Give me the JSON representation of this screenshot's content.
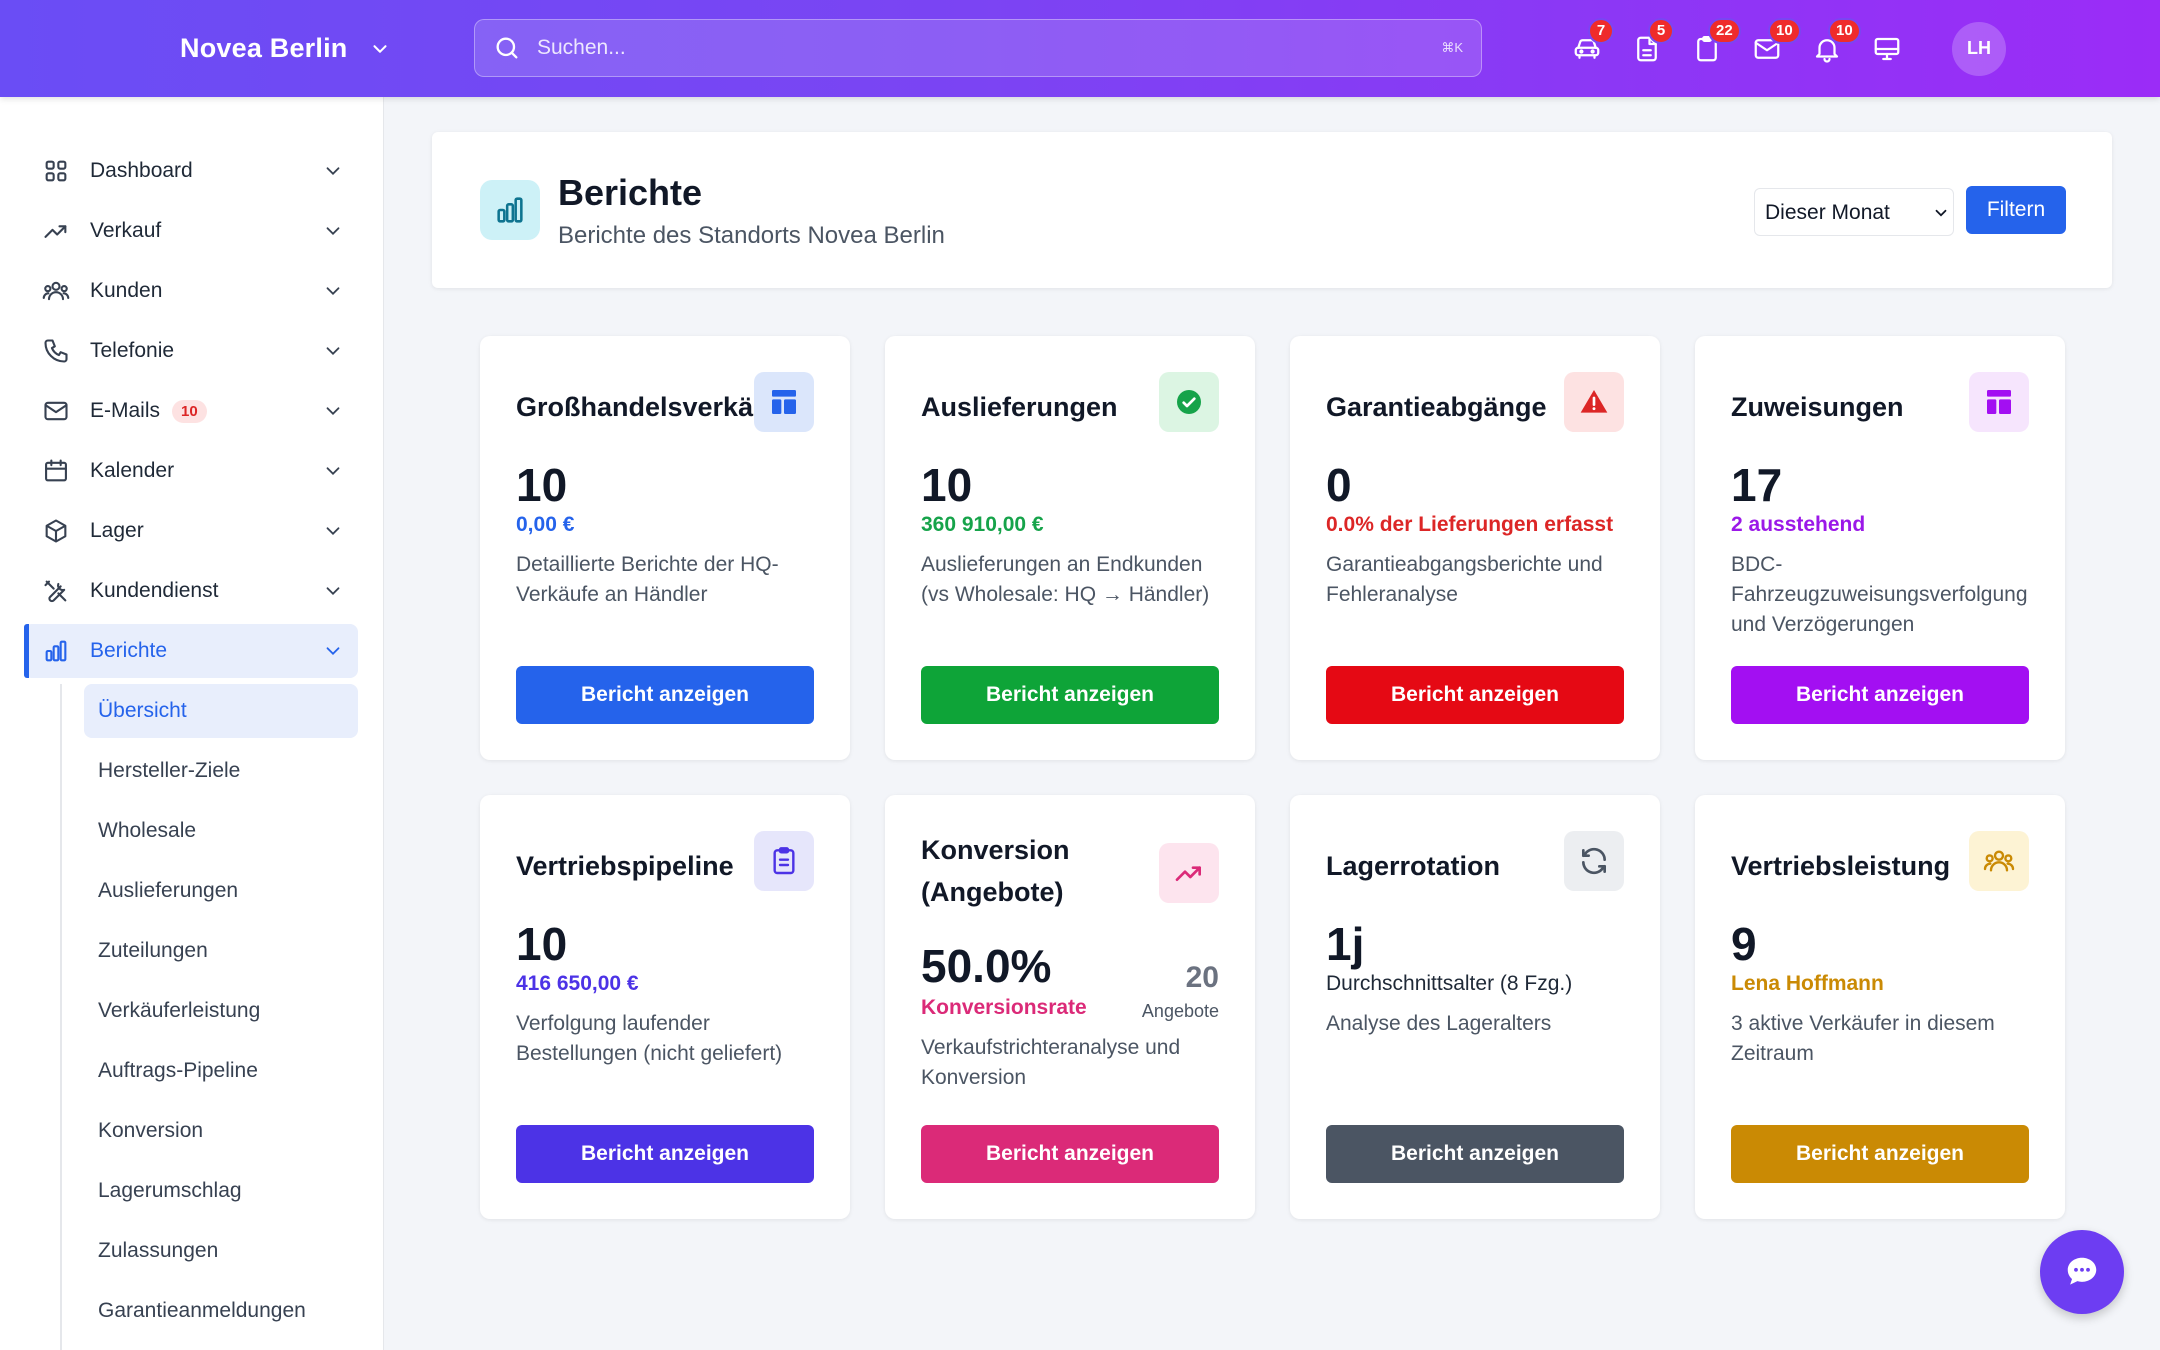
{
  "header": {
    "brand": "Novea Berlin",
    "search_placeholder": "Suchen...",
    "search_shortcut": "⌘K",
    "icons": [
      {
        "name": "car-icon",
        "badge": "7"
      },
      {
        "name": "document-icon",
        "badge": "5"
      },
      {
        "name": "clipboard-icon",
        "badge": "22"
      },
      {
        "name": "mail-icon",
        "badge": "10"
      },
      {
        "name": "bell-icon",
        "badge": "10"
      },
      {
        "name": "monitor-icon",
        "badge": ""
      }
    ],
    "avatar": "LH"
  },
  "sidebar": {
    "items": [
      {
        "label": "Dashboard",
        "icon": "grid-icon"
      },
      {
        "label": "Verkauf",
        "icon": "trend-icon"
      },
      {
        "label": "Kunden",
        "icon": "users-icon"
      },
      {
        "label": "Telefonie",
        "icon": "phone-icon"
      },
      {
        "label": "E-Mails",
        "icon": "mail-icon",
        "badge": "10"
      },
      {
        "label": "Kalender",
        "icon": "calendar-icon"
      },
      {
        "label": "Lager",
        "icon": "box-icon"
      },
      {
        "label": "Kundendienst",
        "icon": "tools-icon"
      },
      {
        "label": "Berichte",
        "icon": "chart-icon",
        "active": true
      }
    ],
    "sub_items": [
      {
        "label": "Übersicht",
        "active": true
      },
      {
        "label": "Hersteller-Ziele"
      },
      {
        "label": "Wholesale"
      },
      {
        "label": "Auslieferungen"
      },
      {
        "label": "Zuteilungen"
      },
      {
        "label": "Verkäuferleistung"
      },
      {
        "label": "Auftrags-Pipeline"
      },
      {
        "label": "Konversion"
      },
      {
        "label": "Lagerumschlag"
      },
      {
        "label": "Zulassungen"
      },
      {
        "label": "Garantieanmeldungen"
      }
    ]
  },
  "page": {
    "title": "Berichte",
    "subtitle": "Berichte des Standorts Novea Berlin",
    "period": "Dieser Monat",
    "period_options": [
      "Dieser Monat"
    ],
    "filter_label": "Filtern"
  },
  "colors": {
    "blue": "#2563eb",
    "green": "#0ea438",
    "red": "#e50914",
    "purple": "#a30ff2",
    "indigo": "#4c33e6",
    "pink": "#db2a78",
    "gray": "#4b5563",
    "amber": "#ca8a04"
  },
  "cards": [
    {
      "title": "Großhandelsverkäufe",
      "value": "10",
      "sub": "0,00 €",
      "desc": "Detaillierte Berichte der HQ-Verkäufe an Händler",
      "button": "Bericht anzeigen"
    },
    {
      "title": "Auslieferungen",
      "value": "10",
      "sub": "360 910,00 €",
      "desc": "Auslieferungen an Endkunden (vs Wholesale: HQ → Händler)",
      "button": "Bericht anzeigen"
    },
    {
      "title": "Garantieabgänge",
      "value": "0",
      "sub": "0.0% der Lieferungen erfasst",
      "desc": "Garantieabgangsberichte und Fehleranalyse",
      "button": "Bericht anzeigen"
    },
    {
      "title": "Zuweisungen",
      "value": "17",
      "sub": "2 ausstehend",
      "desc": "BDC-Fahrzeugzuweisungsverfolgung und Verzögerungen",
      "button": "Bericht anzeigen"
    },
    {
      "title": "Vertriebspipeline",
      "value": "10",
      "sub": "416 650,00 €",
      "desc": "Verfolgung laufender Bestellungen (nicht geliefert)",
      "button": "Bericht anzeigen"
    },
    {
      "title": "Konversion (Angebote)",
      "value": "50.0%",
      "sub": "Konversionsrate",
      "side_value": "20",
      "side_label": "Angebote",
      "desc": "Verkaufstrichteranalyse und Konversion",
      "button": "Bericht anzeigen"
    },
    {
      "title": "Lagerrotation",
      "value": "1j",
      "sub": "Durchschnittsalter (8 Fzg.)",
      "desc": "Analyse des Lageralters",
      "button": "Bericht anzeigen"
    },
    {
      "title": "Vertriebsleistung",
      "value": "9",
      "sub": "Lena Hoffmann",
      "desc": "3 aktive Verkäufer in diesem Zeitraum",
      "button": "Bericht anzeigen"
    }
  ]
}
